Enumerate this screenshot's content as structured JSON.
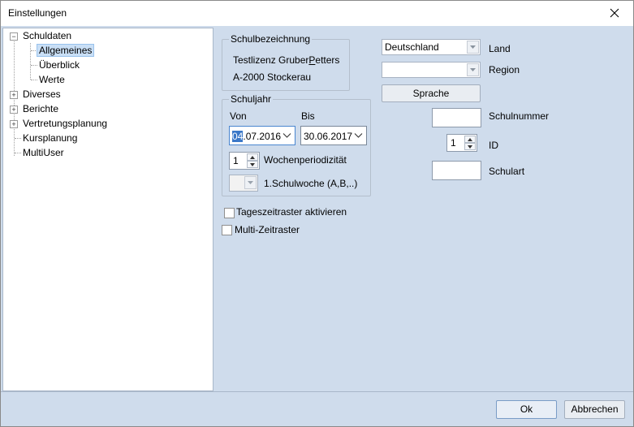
{
  "window": {
    "title": "Einstellungen"
  },
  "tree": {
    "items": [
      {
        "label": "Schuldaten",
        "expander": "−"
      },
      {
        "label": "Allgemeines"
      },
      {
        "label": "Überblick"
      },
      {
        "label": "Werte"
      },
      {
        "label": "Diverses",
        "expander": "+"
      },
      {
        "label": "Berichte",
        "expander": "+"
      },
      {
        "label": "Vertretungsplanung",
        "expander": "+"
      },
      {
        "label": "Kursplanung"
      },
      {
        "label": "MultiUser"
      }
    ]
  },
  "schulbezeichnung": {
    "title": "Schulbezeichnung",
    "line1_pre": "Testlizenz Gruber",
    "line1_ul": "P",
    "line1_post": "etters",
    "line2": "A-2000 Stockerau"
  },
  "schuljahr": {
    "title": "Schuljahr",
    "von_label": "Von",
    "bis_label": "Bis",
    "von_sel": "04",
    "von_rest": ".07.2016",
    "bis_value": "30.06.2017",
    "periodizitaet_value": "1",
    "periodizitaet_label": "Wochenperiodizität",
    "schulwoche_label": "1.Schulwoche (A,B,..)"
  },
  "options": {
    "tageszeitraster": "Tageszeitraster aktivieren",
    "multizeitraster": "Multi-Zeitraster"
  },
  "right": {
    "land_value": "Deutschland",
    "land_label": "Land",
    "region_label": "Region",
    "sprache_button": "Sprache",
    "schulnummer_label": "Schulnummer",
    "id_value": "1",
    "id_label": "ID",
    "schulart_label": "Schulart"
  },
  "footer": {
    "ok": "Ok",
    "cancel": "Abbrechen"
  }
}
